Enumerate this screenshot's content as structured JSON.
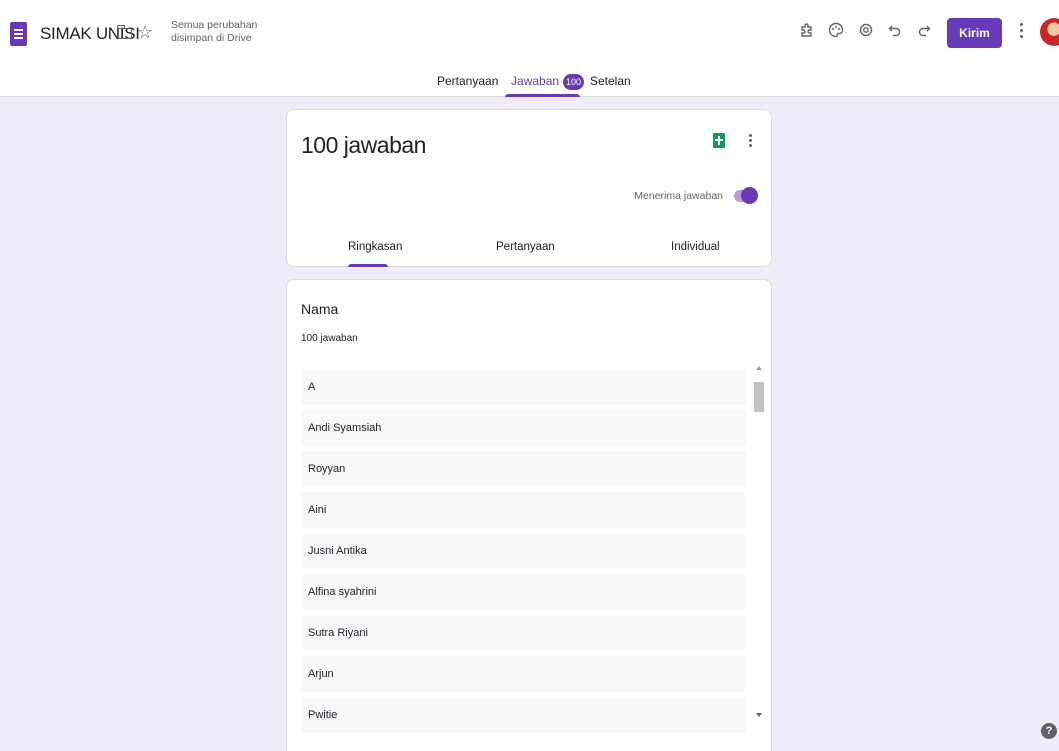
{
  "header": {
    "doc_title": "SIMAK UNISI",
    "save_status": "Semua perubahan disimpan di Drive",
    "send_label": "Kirim",
    "icons": [
      "addon-icon",
      "palette-icon",
      "preview-icon",
      "undo-icon",
      "redo-icon",
      "more-vert-icon"
    ]
  },
  "main_tabs": [
    {
      "label": "Pertanyaan"
    },
    {
      "label": "Jawaban",
      "badge": "100"
    },
    {
      "label": "Setelan"
    }
  ],
  "summary": {
    "count_label": "100 jawaban",
    "accepting_label": "Menerima jawaban",
    "accepting": true,
    "sub_tabs": [
      "Ringkasan",
      "Pertanyaan",
      "Individual"
    ]
  },
  "question": {
    "title": "Nama",
    "count": "100 jawaban",
    "responses": [
      "A",
      "Andi Syamsiah",
      "Royyan",
      "Aini",
      "Jusni Antika",
      "Alfina syahrini",
      "Sutra Riyani",
      "Arjun",
      "Pwitie"
    ]
  },
  "help_label": "?",
  "colors": {
    "accent": "#673ab7",
    "background": "#f0ebf8",
    "sheets": "#0f9d58"
  }
}
